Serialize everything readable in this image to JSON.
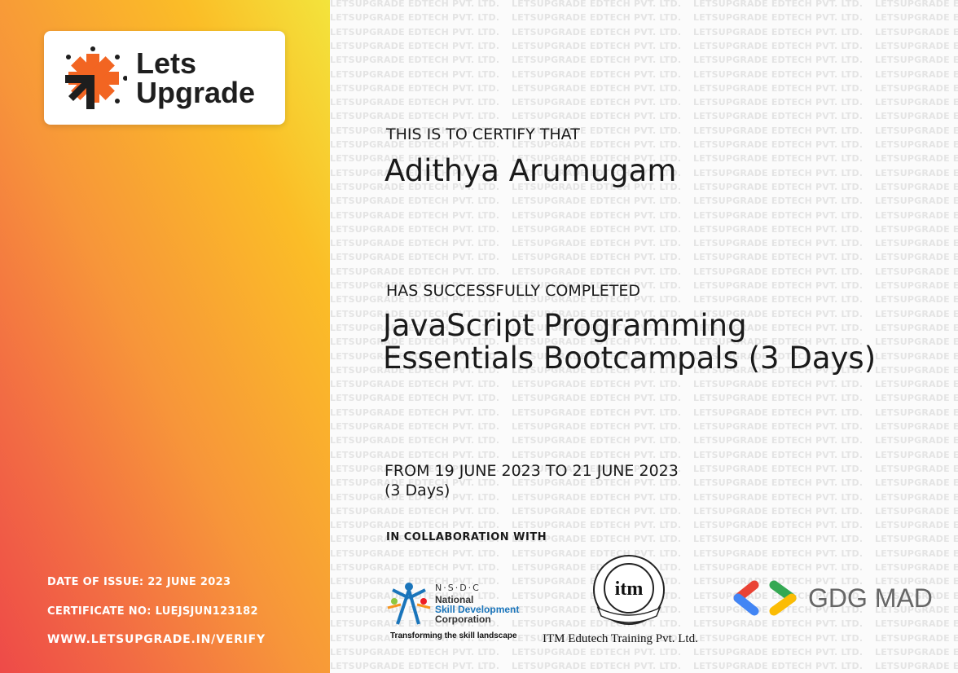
{
  "brand": {
    "logo_line1": "Lets",
    "logo_line2": "Upgrade",
    "accent": "#f26522"
  },
  "watermark": "LETSUPGRADE EDTECH PVT. LTD.",
  "certificate": {
    "intro": "THIS IS TO CERTIFY THAT",
    "name": "Adithya Arumugam",
    "completed": "HAS SUCCESSFULLY COMPLETED",
    "course_line1": "JavaScript Programming",
    "course_line2": "Essentials Bootcampals  (3 Days)",
    "dates": "FROM 19 JUNE 2023 TO 21 JUNE 2023",
    "duration": "(3 Days)",
    "collab": "IN COLLABORATION WITH"
  },
  "meta": {
    "date_of_issue": "DATE OF ISSUE: 22 JUNE 2023",
    "certificate_no": "CERTIFICATE NO: LUEJSJUN123182",
    "verify_url": "WWW.LETSUPGRADE.IN/VERIFY"
  },
  "partners": {
    "nsdc_abbr": "N·S·D·C",
    "nsdc_l1": "National",
    "nsdc_l2": "Skill Development",
    "nsdc_l3": "Corporation",
    "nsdc_tagline": "Transforming the skill landscape",
    "itm_mark": "itm",
    "itm_name": "ITM Edutech Training Pvt. Ltd.",
    "gdg": "GDG MAD"
  }
}
